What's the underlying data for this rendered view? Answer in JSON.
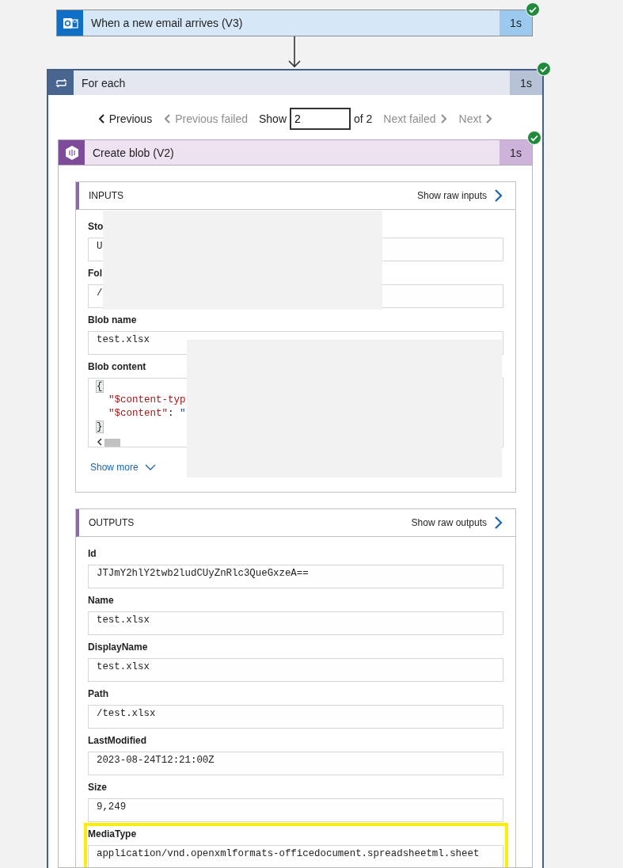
{
  "trigger": {
    "title": "When a new email arrives (V3)",
    "duration": "1s",
    "succeeded": true
  },
  "loop": {
    "title": "For each",
    "duration": "1s",
    "succeeded": true,
    "pager": {
      "items": [
        {
          "kind": "prev",
          "label": "Previous",
          "disabled": false
        },
        {
          "kind": "prev",
          "label": "Previous failed",
          "disabled": true
        }
      ],
      "show_label": "Show",
      "show_value": "2",
      "of_label": "of 2",
      "items_after": [
        {
          "kind": "next",
          "label": "Next failed",
          "disabled": true
        },
        {
          "kind": "next",
          "label": "Next",
          "disabled": true
        }
      ]
    },
    "action": {
      "title": "Create blob (V2)",
      "duration": "1s",
      "succeeded": true,
      "inputs": {
        "heading": "INPUTS",
        "raw_link": "Show raw inputs",
        "show_more": "Show more",
        "fields": [
          {
            "kind": "text",
            "label": "Sto",
            "value": "U",
            "highlighted": false
          },
          {
            "kind": "text",
            "label": "Fol",
            "value": "/",
            "highlighted": false
          },
          {
            "kind": "text",
            "label": "Blob name",
            "value": "test.xlsx",
            "highlighted": false
          },
          {
            "kind": "code",
            "label": "Blob content",
            "highlighted": false,
            "lines": [
              [
                {
                  "kind": "bracket",
                  "text": "{"
                }
              ],
              [
                {
                  "kind": "key",
                  "text": "  \"$content-typ"
                }
              ],
              [
                {
                  "kind": "key",
                  "text": "  \"$content\""
                },
                {
                  "kind": "punct",
                  "text": ": "
                },
                {
                  "kind": "string",
                  "text": "\""
                }
              ],
              [
                {
                  "kind": "bracket",
                  "text": "}"
                }
              ]
            ]
          }
        ]
      },
      "outputs": {
        "heading": "OUTPUTS",
        "raw_link": "Show raw outputs",
        "fields": [
          {
            "kind": "text",
            "label": "Id",
            "value": "JTJmY2hlY2twb2ludCUyZnRlc3QueGxzeA==",
            "highlighted": false
          },
          {
            "kind": "text",
            "label": "Name",
            "value": "test.xlsx",
            "highlighted": false
          },
          {
            "kind": "text",
            "label": "DisplayName",
            "value": "test.xlsx",
            "highlighted": false
          },
          {
            "kind": "text",
            "label": "Path",
            "value": "/test.xlsx",
            "highlighted": false
          },
          {
            "kind": "text",
            "label": "LastModified",
            "value": "2023-08-24T12:21:00Z",
            "highlighted": false
          },
          {
            "kind": "text",
            "label": "Size",
            "value": "9,249",
            "highlighted": false
          },
          {
            "kind": "text",
            "label": "MediaType",
            "value": "application/vnd.openxmlformats-officedocument.spreadsheetml.sheet",
            "highlighted": true
          }
        ]
      }
    }
  }
}
